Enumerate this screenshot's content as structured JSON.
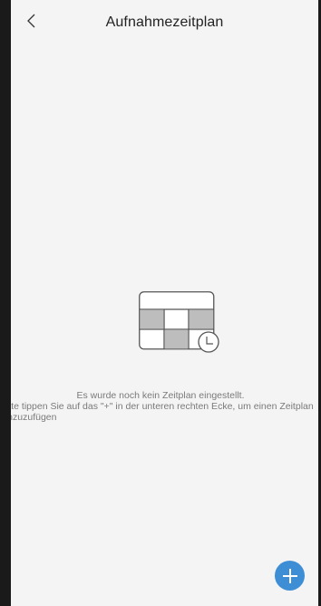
{
  "header": {
    "title": "Aufnahmezeitplan",
    "back_icon": "chevron-left-icon"
  },
  "empty_state": {
    "icon": "calendar-clock-icon",
    "message_line1": "Es wurde noch kein Zeitplan eingestellt.",
    "message_line2": "Bitte tippen Sie auf das \"+\" in der unteren rechten Ecke, um einen Zeitplan hinzuzufügen"
  },
  "fab": {
    "icon": "plus-icon",
    "color": "#3e8ed6"
  },
  "colors": {
    "background": "#f4f4f5",
    "grid_gray": "#bdbdbd",
    "text_gray": "#7a7a7a"
  }
}
